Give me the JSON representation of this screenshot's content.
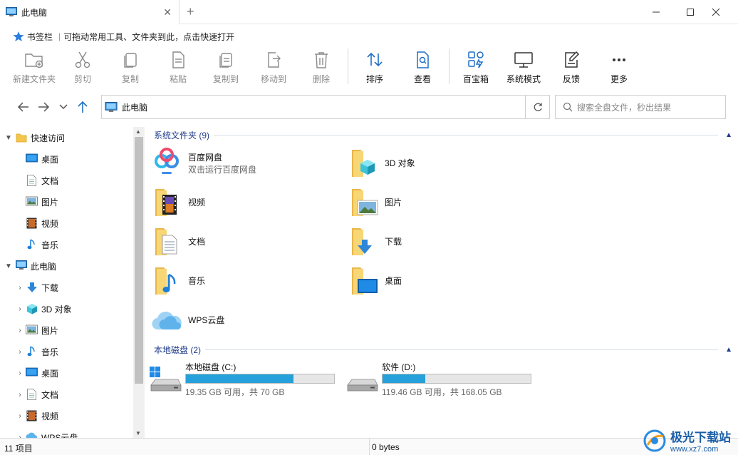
{
  "window": {
    "tab_title": "此电脑",
    "new_tab_icon": "plus-icon"
  },
  "bookmark_bar": {
    "label": "书签栏",
    "hint": "可拖动常用工具、文件夹到此，点击快速打开"
  },
  "toolbar": {
    "items": [
      {
        "label": "新建文件夹",
        "icon": "new-folder-icon",
        "enabled": false
      },
      {
        "label": "剪切",
        "icon": "scissors-icon",
        "enabled": false
      },
      {
        "label": "复制",
        "icon": "copy-icon",
        "enabled": false
      },
      {
        "label": "粘贴",
        "icon": "paste-icon",
        "enabled": false
      },
      {
        "label": "复制到",
        "icon": "copy-to-icon",
        "enabled": false
      },
      {
        "label": "移动到",
        "icon": "move-to-icon",
        "enabled": false
      },
      {
        "label": "删除",
        "icon": "trash-icon",
        "enabled": false
      },
      {
        "label": "排序",
        "icon": "sort-icon",
        "enabled": true
      },
      {
        "label": "查看",
        "icon": "view-icon",
        "enabled": true
      },
      {
        "label": "百宝箱",
        "icon": "toolbox-icon",
        "enabled": true
      },
      {
        "label": "系统模式",
        "icon": "monitor-icon",
        "enabled": true
      },
      {
        "label": "反馈",
        "icon": "feedback-icon",
        "enabled": true
      },
      {
        "label": "更多",
        "icon": "more-icon",
        "enabled": true
      }
    ]
  },
  "address": {
    "path": "此电脑",
    "search_placeholder": "搜索全盘文件，秒出结果"
  },
  "sidebar": {
    "items": [
      {
        "label": "快速访问",
        "icon": "star-folder-icon",
        "level": 0,
        "expand": "expanded"
      },
      {
        "label": "桌面",
        "icon": "desktop-icon",
        "level": 1,
        "expand": "none"
      },
      {
        "label": "文档",
        "icon": "document-icon",
        "level": 1,
        "expand": "none"
      },
      {
        "label": "图片",
        "icon": "picture-icon",
        "level": 1,
        "expand": "none"
      },
      {
        "label": "视频",
        "icon": "video-icon",
        "level": 1,
        "expand": "none"
      },
      {
        "label": "音乐",
        "icon": "music-icon",
        "level": 1,
        "expand": "none"
      },
      {
        "label": "此电脑",
        "icon": "computer-icon",
        "level": 0,
        "expand": "expanded"
      },
      {
        "label": "下载",
        "icon": "download-icon",
        "level": 1,
        "expand": "collapsed"
      },
      {
        "label": "3D 对象",
        "icon": "cube-icon",
        "level": 1,
        "expand": "collapsed"
      },
      {
        "label": "图片",
        "icon": "picture-icon",
        "level": 1,
        "expand": "collapsed"
      },
      {
        "label": "音乐",
        "icon": "music-icon",
        "level": 1,
        "expand": "collapsed"
      },
      {
        "label": "桌面",
        "icon": "desktop-icon",
        "level": 1,
        "expand": "collapsed"
      },
      {
        "label": "文档",
        "icon": "document-icon",
        "level": 1,
        "expand": "collapsed"
      },
      {
        "label": "视频",
        "icon": "video-icon",
        "level": 1,
        "expand": "collapsed"
      },
      {
        "label": "WPS云盘",
        "icon": "cloud-icon",
        "level": 1,
        "expand": "collapsed"
      }
    ]
  },
  "groups": {
    "system_folders": {
      "title": "系统文件夹 (9)",
      "items": [
        {
          "name": "百度网盘",
          "sub": "双击运行百度网盘",
          "icon": "baidu-netdisk-icon"
        },
        {
          "name": "3D 对象",
          "sub": "",
          "icon": "folder-3d-icon"
        },
        {
          "name": "视频",
          "sub": "",
          "icon": "folder-video-icon"
        },
        {
          "name": "图片",
          "sub": "",
          "icon": "folder-picture-icon"
        },
        {
          "name": "文档",
          "sub": "",
          "icon": "folder-document-icon"
        },
        {
          "name": "下载",
          "sub": "",
          "icon": "folder-download-icon"
        },
        {
          "name": "音乐",
          "sub": "",
          "icon": "folder-music-icon"
        },
        {
          "name": "桌面",
          "sub": "",
          "icon": "folder-desktop-icon"
        },
        {
          "name": "WPS云盘",
          "sub": "",
          "icon": "wps-cloud-icon"
        }
      ]
    },
    "local_disks": {
      "title": "本地磁盘 (2)",
      "drives": [
        {
          "name": "本地磁盘 (C:)",
          "info": "19.35 GB 可用，共 70 GB",
          "used_fraction": 0.724,
          "icon": "windows-drive-icon"
        },
        {
          "name": "软件 (D:)",
          "info": "119.46 GB 可用，共 168.05 GB",
          "used_fraction": 0.289,
          "icon": "drive-icon"
        }
      ]
    }
  },
  "status": {
    "item_count": "11 项目",
    "selection_size": "0 bytes"
  },
  "watermark": {
    "text1": "极光下载站",
    "text2": "www.xz7.com"
  },
  "colors": {
    "accent": "#1f6fc5",
    "drive_fill": "#26a0da",
    "group_header": "#1f3b8a"
  }
}
